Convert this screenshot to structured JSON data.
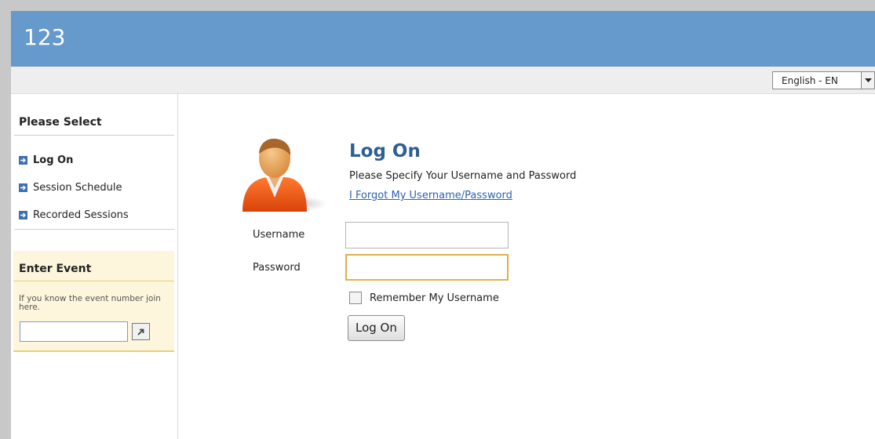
{
  "header": {
    "title": "123",
    "accent": "#6699cc"
  },
  "language": {
    "selected": "English - EN",
    "icon": "chevron-down-icon"
  },
  "sidebar": {
    "heading": "Please Select",
    "items": [
      {
        "label": "Log On",
        "active": true,
        "icon": "arrow-right-icon"
      },
      {
        "label": "Session Schedule",
        "active": false,
        "icon": "arrow-right-icon"
      },
      {
        "label": "Recorded Sessions",
        "active": false,
        "icon": "arrow-right-icon"
      }
    ]
  },
  "event": {
    "title": "Enter Event",
    "help": "If you know the event number join here.",
    "input_value": "",
    "go_icon": "arrow-up-right-icon"
  },
  "login": {
    "title": "Log On",
    "subtitle": "Please Specify Your Username and Password",
    "forgot_link": "I Forgot My Username/Password",
    "username_label": "Username",
    "username_value": "",
    "password_label": "Password",
    "password_value": "",
    "remember_label": "Remember My Username",
    "remember_checked": false,
    "submit_label": "Log On",
    "avatar_icon": "user-avatar-icon"
  }
}
